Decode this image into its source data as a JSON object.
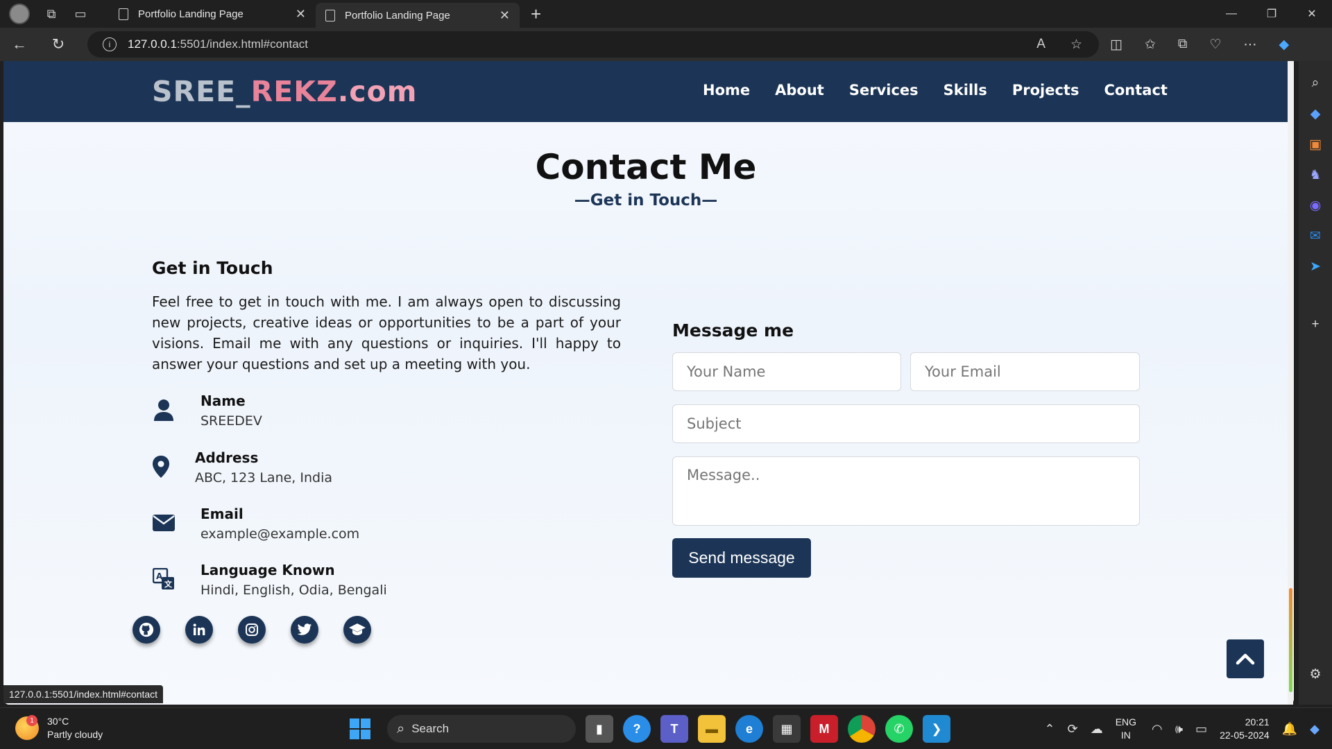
{
  "browser": {
    "tabs": [
      {
        "title": "Portfolio Landing Page"
      },
      {
        "title": "Portfolio Landing Page"
      }
    ],
    "url_host": "127.0.0.1",
    "url_path": ":5501/index.html#contact",
    "status_url": "127.0.0.1:5501/index.html#contact"
  },
  "site": {
    "logo": {
      "part1": "SREE_",
      "part2": "REKZ",
      "part3": ".com"
    },
    "nav": [
      "Home",
      "About",
      "Services",
      "Skills",
      "Projects",
      "Contact"
    ]
  },
  "contact": {
    "title": "Contact Me",
    "subtitle": "—Get in Touch—",
    "left": {
      "heading": "Get in Touch",
      "paragraph": "Feel free to get in touch with me. I am always open to discussing new projects, creative ideas or opportunities to be a part of your visions. Email me with any questions or inquiries. I'll happy to answer your questions and set up a meeting with you.",
      "items": [
        {
          "icon": "user-icon",
          "label": "Name",
          "value": "SREEDEV"
        },
        {
          "icon": "location-pin-icon",
          "label": "Address",
          "value": "ABC, 123 Lane, India"
        },
        {
          "icon": "envelope-icon",
          "label": "Email",
          "value": "example@example.com"
        },
        {
          "icon": "language-icon",
          "label": "Language Known",
          "value": "Hindi, English, Odia, Bengali"
        }
      ],
      "socials": [
        "github-icon",
        "linkedin-icon",
        "instagram-icon",
        "twitter-icon",
        "graduation-cap-icon"
      ]
    },
    "form": {
      "heading": "Message me",
      "name_placeholder": "Your Name",
      "email_placeholder": "Your Email",
      "subject_placeholder": "Subject",
      "message_placeholder": "Message..",
      "submit_label": "Send message"
    }
  },
  "taskbar": {
    "weather": {
      "temp": "30°C",
      "desc": "Partly cloudy",
      "badge": "1"
    },
    "search_label": "Search",
    "lang": {
      "line1": "ENG",
      "line2": "IN"
    },
    "time": "20:21",
    "date": "22-05-2024"
  },
  "colors": {
    "brand_navy": "#1c3556",
    "logo_pink": "#e9839a"
  }
}
